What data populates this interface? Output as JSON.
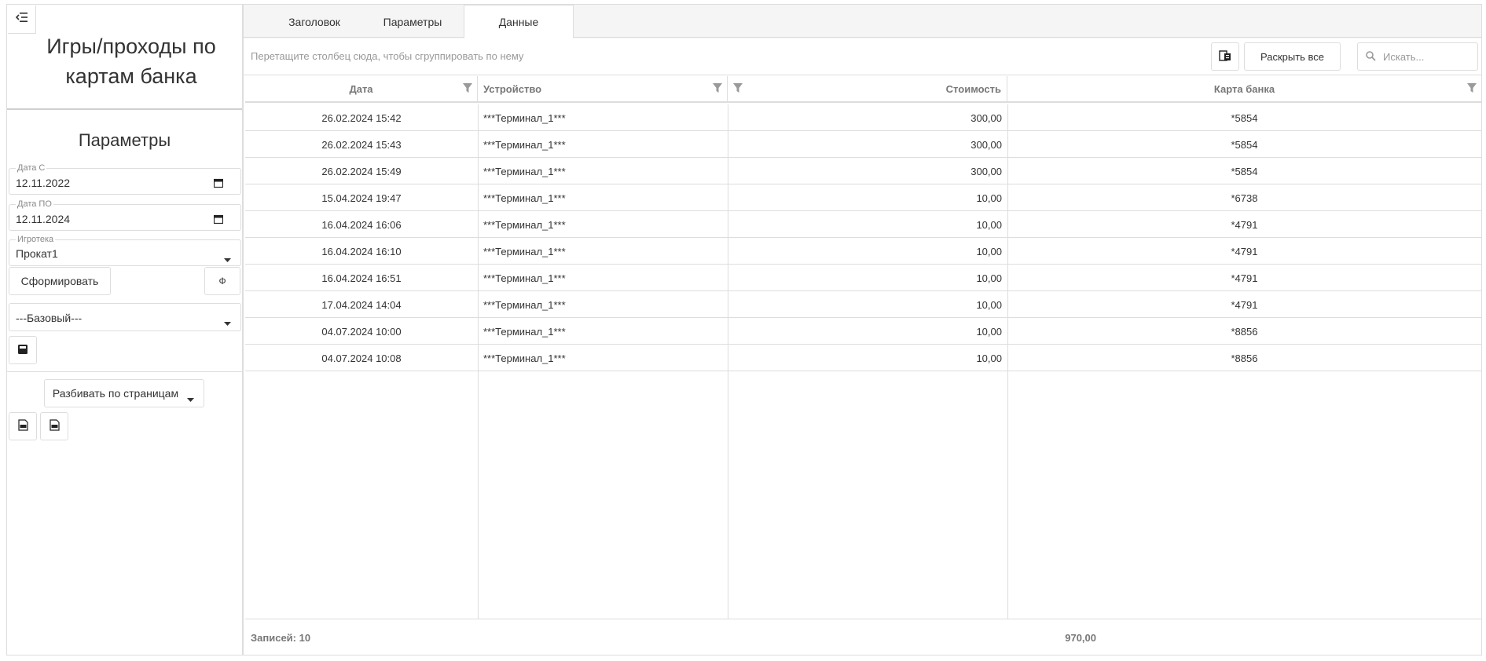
{
  "report": {
    "title": "Игры/проходы по картам банка"
  },
  "params": {
    "heading": "Параметры",
    "date_from": {
      "label": "Дата С",
      "value": "12.11.2022"
    },
    "date_to": {
      "label": "Дата ПО",
      "value": "12.11.2024"
    },
    "game_library": {
      "label": "Игротека",
      "value": "Прокат1"
    },
    "generate_label": "Сформировать",
    "phi_label": "Ф",
    "preset": "---Базовый---",
    "paging": "Разбивать по страницам"
  },
  "tabs": [
    {
      "label": "Заголовок"
    },
    {
      "label": "Параметры"
    },
    {
      "label": "Данные",
      "active": true
    }
  ],
  "toolbar": {
    "group_hint": "Перетащите столбец сюда, чтобы сгруппировать по нему",
    "expand_all": "Раскрыть все",
    "search_placeholder": "Искать..."
  },
  "grid": {
    "columns": [
      {
        "label": "Дата"
      },
      {
        "label": "Устройство"
      },
      {
        "label": "Стоимость"
      },
      {
        "label": "Карта банка"
      }
    ],
    "rows": [
      [
        "26.02.2024 15:42",
        "***Терминал_1***",
        "300,00",
        "*5854"
      ],
      [
        "26.02.2024 15:43",
        "***Терминал_1***",
        "300,00",
        "*5854"
      ],
      [
        "26.02.2024 15:49",
        "***Терминал_1***",
        "300,00",
        "*5854"
      ],
      [
        "15.04.2024 19:47",
        "***Терминал_1***",
        "10,00",
        "*6738"
      ],
      [
        "16.04.2024 16:06",
        "***Терминал_1***",
        "10,00",
        "*4791"
      ],
      [
        "16.04.2024 16:10",
        "***Терминал_1***",
        "10,00",
        "*4791"
      ],
      [
        "16.04.2024 16:51",
        "***Терминал_1***",
        "10,00",
        "*4791"
      ],
      [
        "17.04.2024 14:04",
        "***Терминал_1***",
        "10,00",
        "*4791"
      ],
      [
        "04.07.2024 10:00",
        "***Терминал_1***",
        "10,00",
        "*8856"
      ],
      [
        "04.07.2024 10:08",
        "***Терминал_1***",
        "10,00",
        "*8856"
      ]
    ],
    "footer": {
      "records": "Записей: 10",
      "total": "970,00"
    }
  },
  "colors": {
    "border": "#dddddd",
    "header_text": "#777777",
    "text": "#333333",
    "panel_bg": "#f5f5f5"
  }
}
